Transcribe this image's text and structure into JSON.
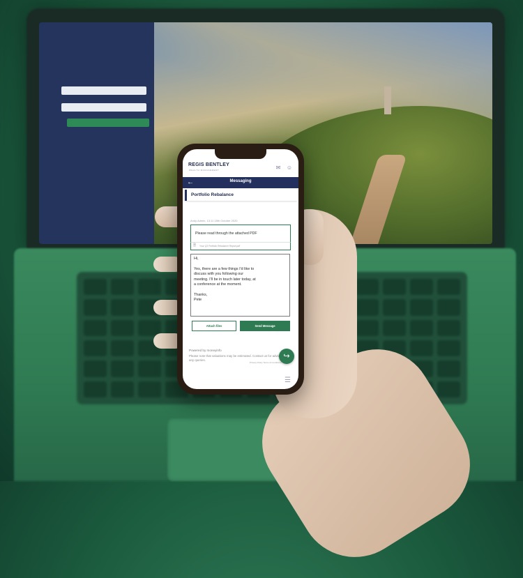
{
  "app": {
    "brand": "REGIS BENTLEY",
    "brand_sub": "WEALTH MANAGEMENT",
    "nav_title": "Messaging",
    "back_icon": "←",
    "mail_icon": "✉",
    "user_icon": "☺"
  },
  "conversation": {
    "subject": "Portfolio Rebalance",
    "meta": "Andy Admin, 13:11 18th October 2020",
    "message": "Please read through the attached PDF",
    "attachment": "Your Q3 Portfolio Rebalance Report.pdf"
  },
  "reply": {
    "lines": [
      "Hi,",
      "",
      "Yes, there are a few things I'd like to",
      "discuss with you following our",
      "meeting. I'll be in touch later today, at",
      "a conference at the moment.",
      "",
      "Thanks,",
      "Pete"
    ]
  },
  "actions": {
    "attach_files": "Attach files",
    "send_message": "Send Message"
  },
  "footer": {
    "powered_by": "Powered by moneyinfo",
    "disclaimer": "Please note that valuations may be estimated. Contact us for advice or with any queries.",
    "links": "Privacy Policy    Terms & Conditions"
  },
  "icons": {
    "fab": "↪",
    "menu": "☰"
  },
  "colors": {
    "navy": "#232f5c",
    "green": "#2e7a52"
  }
}
